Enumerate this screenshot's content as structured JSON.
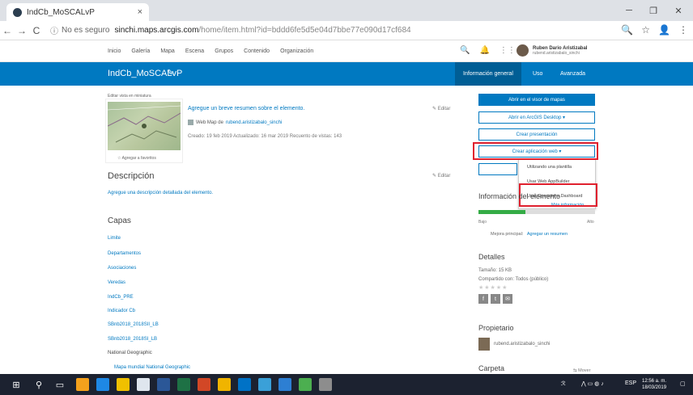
{
  "browser": {
    "tab_title": "IndCb_MoSCALvP",
    "tab_close": "×",
    "win_min": "─",
    "win_restore": "❐",
    "win_close": "✕",
    "back": "←",
    "forward": "→",
    "reload": "C",
    "info_icon": "ⓘ",
    "secure_label": "No es seguro",
    "url_host": "sinchi.maps.arcgis.com",
    "url_path": "/home/item.html?id=bddd6fe5d5e04d7bbe77e090d17cf684",
    "zoom_icon": "🔍",
    "star_icon": "☆",
    "profile_icon": "👤",
    "menu_icon": "⋮"
  },
  "agsnav": {
    "links": [
      "Inicio",
      "Galería",
      "Mapa",
      "Escena",
      "Grupos",
      "Contenido",
      "Organización"
    ],
    "search_icon": "🔍",
    "bell_icon": "🔔",
    "apps_icon": "⋮⋮⋮",
    "user_name": "Ruben Dario Aristizabal",
    "user_id": "rubend.aristizabalo_sinchi"
  },
  "titlebar": {
    "title": "IndCb_MoSCALvP",
    "edit_icon": "✎",
    "tabs": [
      "Información general",
      "Uso",
      "Avanzada"
    ]
  },
  "item": {
    "thumb_label": "Editar vista en miniatura",
    "add_favorites": "☆ Agregar a favoritos",
    "summary": "Agregue un breve resumen sobre el elemento.",
    "type": "Web Map de",
    "owner": "rubend.aristizabalo_sinchi",
    "meta": "Creado: 19 feb 2019   Actualizado: 16 mar 2019   Recuento de vistas: 143",
    "edit_label": "✎ Editar"
  },
  "description": {
    "heading": "Descripción",
    "link": "Agregue una descripción detallada del elemento."
  },
  "layers": {
    "heading": "Capas",
    "items": [
      "Limite",
      "Departamentos",
      "Asociaciones",
      "Veredas",
      "IndCb_PRE",
      "Indicador Cb",
      "SBnb2018_2018SII_LB",
      "SBnb2018_2018SI_LB"
    ],
    "national_geo": "National Geographic",
    "basemap": "Mapa mundial National Geographic"
  },
  "actions": {
    "open_viewer": "Abrir en el visor de mapas",
    "open_desktop": "Abrir en ArcGIS Desktop ▾",
    "create_presentation": "Crear presentación",
    "create_webapp": "Crear aplicación web ▾",
    "dropdown": [
      "Utilizando una plantilla",
      "Usar Web AppBuilder",
      "Usar Operations Dashboard",
      "Más información"
    ]
  },
  "info": {
    "heading": "Información del elemento",
    "progress": 0.4,
    "low": "Bajo",
    "high": "Alto",
    "improve": "Mejora principal:",
    "improve_link": "Agregar un resumen",
    "bar_color": "#35ac46"
  },
  "details": {
    "heading": "Detalles",
    "size": "Tamaño: 15 KB",
    "shared": "Compartido con: Todos (público)",
    "stars": "★★★★★",
    "share_icons": [
      "f",
      "t",
      "✉"
    ]
  },
  "owner": {
    "heading": "Propietario",
    "name": "rubend.aristizabalo_sinchi"
  },
  "folder": {
    "heading": "Carpeta",
    "move": "⇆ Mover"
  },
  "taskbar": {
    "start_icon": "⊞",
    "search_icon": "⚲",
    "taskview_icon": "▭",
    "lang": "ESP",
    "time": "12:56 a. m.",
    "date": "18/03/2019",
    "tray": "⋀ ▭ ◍ ♪",
    "notif_icon": "▢"
  }
}
